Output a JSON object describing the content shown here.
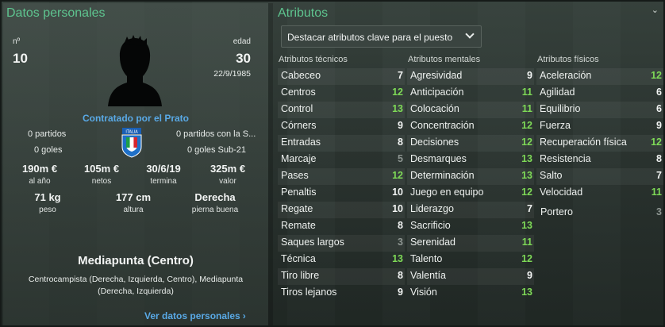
{
  "left": {
    "title": "Datos personales",
    "number_label": "nº",
    "number": "10",
    "age_label": "edad",
    "age": "30",
    "birthdate": "22/9/1985",
    "hired": "Contratado por el Prato",
    "matches": "0 partidos",
    "goals": "0 goles",
    "intl_matches": "0 partidos con la S...",
    "intl_goals": "0 goles Sub-21",
    "badge_text": "ITALIA",
    "wage": "190m €",
    "wage_label": "al año",
    "net": "105m €",
    "net_label": "netos",
    "expires": "30/6/19",
    "expires_label": "termina",
    "value": "325m €",
    "value_label": "valor",
    "weight": "71 kg",
    "weight_label": "peso",
    "height": "177 cm",
    "height_label": "altura",
    "foot": "Derecha",
    "foot_label": "pierna buena",
    "position": "Mediapunta (Centro)",
    "position_detail": "Centrocampista (Derecha, Izquierda, Centro), Mediapunta (Derecha, Izquierda)",
    "more_link": "Ver datos personales"
  },
  "right": {
    "title": "Atributos",
    "dropdown": "Destacar atributos clave para el puesto",
    "technical_title": "Atributos técnicos",
    "mental_title": "Atributos mentales",
    "physical_title": "Atributos físicos",
    "technical": [
      {
        "name": "Cabeceo",
        "value": "7",
        "tone": "white"
      },
      {
        "name": "Centros",
        "value": "12",
        "tone": "green"
      },
      {
        "name": "Control",
        "value": "13",
        "tone": "green"
      },
      {
        "name": "Córners",
        "value": "9",
        "tone": "white"
      },
      {
        "name": "Entradas",
        "value": "8",
        "tone": "white"
      },
      {
        "name": "Marcaje",
        "value": "5",
        "tone": "grey"
      },
      {
        "name": "Pases",
        "value": "12",
        "tone": "green"
      },
      {
        "name": "Penaltis",
        "value": "10",
        "tone": "white"
      },
      {
        "name": "Regate",
        "value": "10",
        "tone": "white"
      },
      {
        "name": "Remate",
        "value": "8",
        "tone": "white"
      },
      {
        "name": "Saques largos",
        "value": "3",
        "tone": "grey"
      },
      {
        "name": "Técnica",
        "value": "13",
        "tone": "green"
      },
      {
        "name": "Tiro libre",
        "value": "8",
        "tone": "white"
      },
      {
        "name": "Tiros lejanos",
        "value": "9",
        "tone": "white"
      }
    ],
    "mental": [
      {
        "name": "Agresividad",
        "value": "9",
        "tone": "white"
      },
      {
        "name": "Anticipación",
        "value": "11",
        "tone": "green"
      },
      {
        "name": "Colocación",
        "value": "11",
        "tone": "green"
      },
      {
        "name": "Concentración",
        "value": "12",
        "tone": "green"
      },
      {
        "name": "Decisiones",
        "value": "12",
        "tone": "green"
      },
      {
        "name": "Desmarques",
        "value": "13",
        "tone": "green"
      },
      {
        "name": "Determinación",
        "value": "13",
        "tone": "green"
      },
      {
        "name": "Juego en equipo",
        "value": "12",
        "tone": "green"
      },
      {
        "name": "Liderazgo",
        "value": "7",
        "tone": "white"
      },
      {
        "name": "Sacrificio",
        "value": "13",
        "tone": "green"
      },
      {
        "name": "Serenidad",
        "value": "11",
        "tone": "green"
      },
      {
        "name": "Talento",
        "value": "12",
        "tone": "green"
      },
      {
        "name": "Valentía",
        "value": "9",
        "tone": "white"
      },
      {
        "name": "Visión",
        "value": "13",
        "tone": "green"
      }
    ],
    "physical": [
      {
        "name": "Aceleración",
        "value": "12",
        "tone": "green"
      },
      {
        "name": "Agilidad",
        "value": "6",
        "tone": "white"
      },
      {
        "name": "Equilibrio",
        "value": "6",
        "tone": "white"
      },
      {
        "name": "Fuerza",
        "value": "9",
        "tone": "white"
      },
      {
        "name": "Recuperación física",
        "value": "12",
        "tone": "green"
      },
      {
        "name": "Resistencia",
        "value": "8",
        "tone": "white"
      },
      {
        "name": "Salto",
        "value": "7",
        "tone": "white"
      },
      {
        "name": "Velocidad",
        "value": "11",
        "tone": "green"
      }
    ],
    "goalkeeper": {
      "name": "Portero",
      "value": "3",
      "tone": "grey"
    }
  },
  "colors": {
    "accent_green": "#5ec48f",
    "link_blue": "#59a9e6",
    "good_value": "#7ed957",
    "poor_value": "#8d9591"
  }
}
